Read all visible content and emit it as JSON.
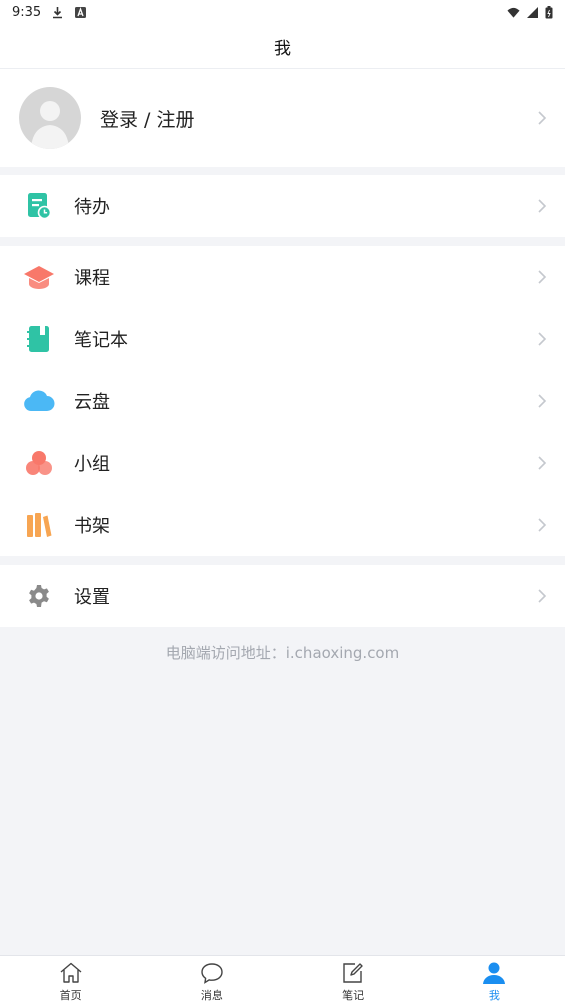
{
  "status_bar": {
    "time": "9:35"
  },
  "header": {
    "title": "我"
  },
  "profile": {
    "login_label": "登录 / 注册"
  },
  "groups": [
    {
      "items": [
        {
          "label": "待办",
          "icon": "todo-icon",
          "color": "#2fc3a5"
        }
      ]
    },
    {
      "items": [
        {
          "label": "课程",
          "icon": "course-cap-icon",
          "color": "#f8786a"
        },
        {
          "label": "笔记本",
          "icon": "notebook-icon",
          "color": "#2fc3a5"
        },
        {
          "label": "云盘",
          "icon": "cloud-icon",
          "color": "#4bb8f5"
        },
        {
          "label": "小组",
          "icon": "group-icon",
          "color": "#f8786a"
        },
        {
          "label": "书架",
          "icon": "bookshelf-icon",
          "color": "#f7a552"
        }
      ]
    },
    {
      "items": [
        {
          "label": "设置",
          "icon": "gear-icon",
          "color": "#8a8a8a"
        }
      ]
    }
  ],
  "footer": {
    "note": "电脑端访问地址：i.chaoxing.com"
  },
  "tabbar": {
    "active_color": "#1a8ef0",
    "tabs": [
      {
        "label": "首页",
        "icon": "home-icon"
      },
      {
        "label": "消息",
        "icon": "message-icon"
      },
      {
        "label": "笔记",
        "icon": "note-edit-icon"
      },
      {
        "label": "我",
        "icon": "person-icon"
      }
    ]
  }
}
